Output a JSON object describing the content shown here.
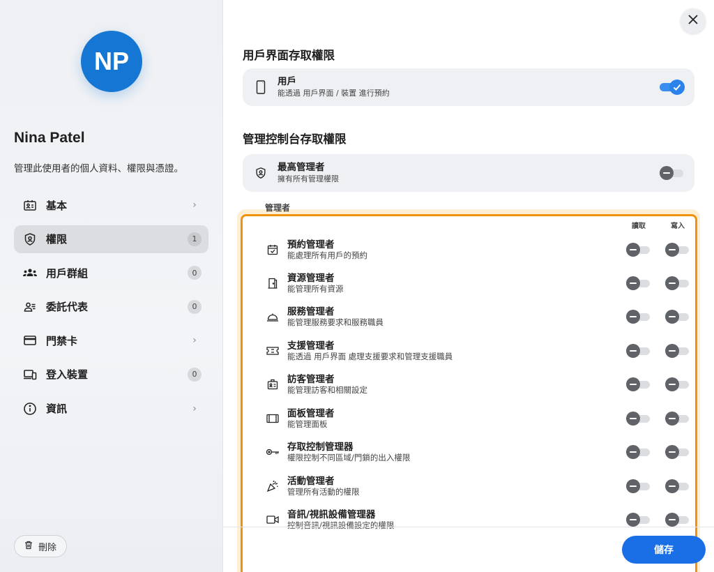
{
  "user": {
    "initials": "NP",
    "name": "Nina Patel",
    "description": "管理此使用者的個人資料、權限與憑證。"
  },
  "nav": [
    {
      "label": "基本",
      "icon": "id-card-icon",
      "badge": null,
      "chevron": "›"
    },
    {
      "label": "權限",
      "icon": "shield-icon",
      "badge": "1",
      "chevron": null
    },
    {
      "label": "用戶群組",
      "icon": "group-icon",
      "badge": "0",
      "chevron": null
    },
    {
      "label": "委託代表",
      "icon": "delegate-icon",
      "badge": "0",
      "chevron": null
    },
    {
      "label": "門禁卡",
      "icon": "card-icon",
      "badge": null,
      "chevron": "›"
    },
    {
      "label": "登入裝置",
      "icon": "devices-icon",
      "badge": "0",
      "chevron": null
    },
    {
      "label": "資訊",
      "icon": "info-icon",
      "badge": null,
      "chevron": "›"
    }
  ],
  "delete_label": "刪除",
  "ui_access": {
    "title": "用戶界面存取權限",
    "card": {
      "title": "用戶",
      "subtitle": "能透過 用戶界面 / 裝置 進行預約",
      "enabled": true
    }
  },
  "console_access": {
    "title": "管理控制台存取權限",
    "super": {
      "title": "最高管理者",
      "subtitle": "擁有所有管理權限",
      "enabled": false
    },
    "admins_label": "管理者",
    "read_header": "讀取",
    "write_header": "寫入",
    "roles": [
      {
        "title": "預約管理者",
        "subtitle": "能處理所有用戶的預約",
        "icon": "calendar-check-icon",
        "read": false,
        "write": false
      },
      {
        "title": "資源管理者",
        "subtitle": "能管理所有資源",
        "icon": "door-icon",
        "read": false,
        "write": false
      },
      {
        "title": "服務管理者",
        "subtitle": "能管理服務要求和服務職員",
        "icon": "service-bell-icon",
        "read": false,
        "write": false
      },
      {
        "title": "支援管理者",
        "subtitle": "能透過 用戶界面 處理支援要求和管理支援職員",
        "icon": "ticket-icon",
        "read": false,
        "write": false
      },
      {
        "title": "訪客管理者",
        "subtitle": "能管理訪客和相關設定",
        "icon": "visitor-badge-icon",
        "read": false,
        "write": false
      },
      {
        "title": "面板管理者",
        "subtitle": "能管理面板",
        "icon": "panel-icon",
        "read": false,
        "write": false
      },
      {
        "title": "存取控制管理器",
        "subtitle": "權限控制不同區域/門鎖的出入權限",
        "icon": "key-icon",
        "read": false,
        "write": false
      },
      {
        "title": "活動管理者",
        "subtitle": "管理所有活動的權限",
        "icon": "party-popper-icon",
        "read": false,
        "write": false
      },
      {
        "title": "音訊/視訊設備管理器",
        "subtitle": "控制音訊/視訊設備設定的權限",
        "icon": "video-camera-icon",
        "read": false,
        "write": false
      }
    ]
  },
  "save_label": "儲存",
  "colors": {
    "accent": "#1a6fe6",
    "avatar": "#1577d3",
    "focus": "#f0920e"
  }
}
